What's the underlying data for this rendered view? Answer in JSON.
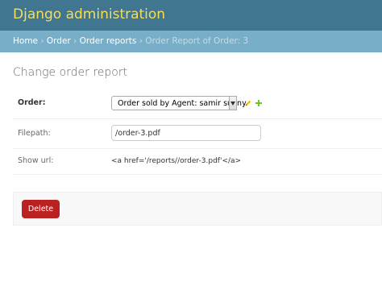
{
  "header": {
    "brand": "Django administration"
  },
  "breadcrumbs": {
    "home": "Home",
    "app": "Order",
    "model": "Order reports",
    "current": "Order Report of Order: 3",
    "separator": "›"
  },
  "page": {
    "title": "Change order report"
  },
  "form": {
    "order": {
      "label": "Order:",
      "selected": "Order sold by Agent: samir sunny"
    },
    "filepath": {
      "label": "Filepath:",
      "value": "/order-3.pdf"
    },
    "show_url": {
      "label": "Show url:",
      "value": "<a href='/reports//order-3.pdf'</a>"
    }
  },
  "submit": {
    "delete_label": "Delete"
  },
  "colors": {
    "header_bg": "#417690",
    "brand_text": "#f5dd5d",
    "breadcrumb_bg": "#79aec8",
    "delete_bg": "#ba2121",
    "edit_icon": "#efb80b",
    "add_icon": "#70bf2b"
  },
  "icons": {
    "edit": "pencil-icon",
    "add": "plus-icon",
    "dropdown": "chevron-down-icon"
  }
}
